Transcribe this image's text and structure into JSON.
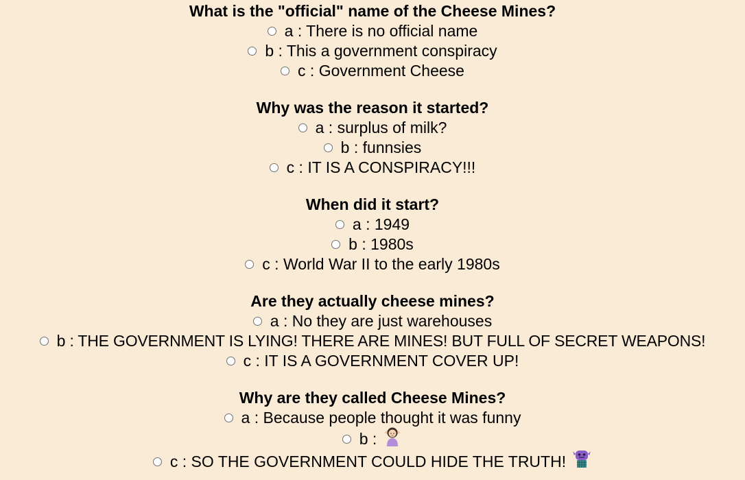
{
  "questions": [
    {
      "title": "What is the \"official\" name of the Cheese Mines?",
      "options": [
        "a : There is no official name",
        "b : This a government conspiracy",
        "c : Government Cheese"
      ]
    },
    {
      "title": "Why was the reason it started?",
      "options": [
        "a : surplus of milk?",
        "b : funnsies",
        "c : IT IS A CONSPIRACY!!!"
      ]
    },
    {
      "title": "When did it start?",
      "options": [
        "a : 1949",
        "b : 1980s",
        "c : World War II to the early 1980s"
      ]
    },
    {
      "title": "Are they actually cheese mines?",
      "options": [
        "a : No they are just warehouses",
        "b : THE GOVERNMENT IS LYING! THERE ARE MINES! BUT FULL OF SECRET WEAPONS!",
        "c : IT IS A GOVERNMENT COVER UP!"
      ]
    },
    {
      "title": "Why are they called Cheese Mines?",
      "options": [
        "a : Because people thought it was funny",
        "b : ",
        "c : SO THE GOVERNMENT COULD HIDE THE TRUTH!"
      ],
      "option_icons": [
        "",
        "person-shrugging-icon",
        "alien-monster-icon"
      ]
    }
  ]
}
